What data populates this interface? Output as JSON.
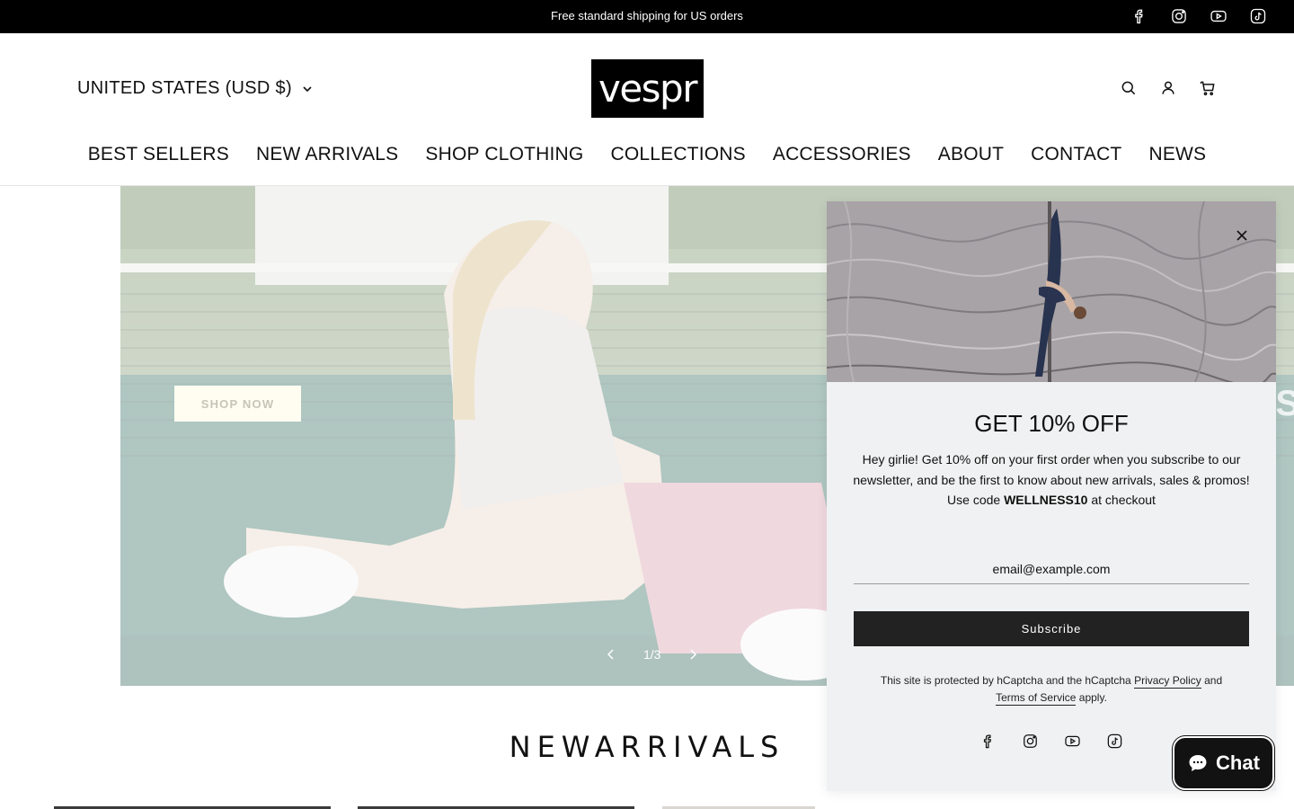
{
  "announcement": {
    "text": "Free standard shipping for US orders",
    "social": [
      "facebook-icon",
      "instagram-icon",
      "youtube-icon",
      "tiktok-icon"
    ]
  },
  "header": {
    "country": "UNITED STATES (USD $)",
    "logo": "vespr",
    "icons": [
      "search-icon",
      "account-icon",
      "cart-icon"
    ],
    "nav": [
      "BEST SELLERS",
      "NEW ARRIVALS",
      "SHOP CLOTHING",
      "COLLECTIONS",
      "ACCESSORIES",
      "ABOUT",
      "CONTACT",
      "NEWS"
    ]
  },
  "hero": {
    "button": "SHOP NOW",
    "slide_counter": "1/3",
    "edge_text": "S"
  },
  "section": {
    "title": "NEWARRIVALS"
  },
  "popup": {
    "title": "GET 10% OFF",
    "body_text": "Hey girlie! Get 10% off on your first order when you subscribe to our newsletter, and be the first to know about new arrivals, sales & promos! Use code",
    "code": "WELLNESS10",
    "body_suffix": "at checkout",
    "email_placeholder": "email@example.com",
    "subscribe_label": "Subscribe",
    "captcha_prefix": "This site is protected by hCaptcha and the hCaptcha",
    "privacy_link": "Privacy Policy",
    "captcha_and": "and",
    "terms_link": "Terms of Service",
    "captcha_suffix": "apply."
  },
  "chat": {
    "label": "Chat"
  },
  "colors": {
    "announcement_bg": "#000000",
    "popup_bg": "#f0f1f2",
    "subscribe_bg": "#222222",
    "chat_bg": "#121212"
  }
}
